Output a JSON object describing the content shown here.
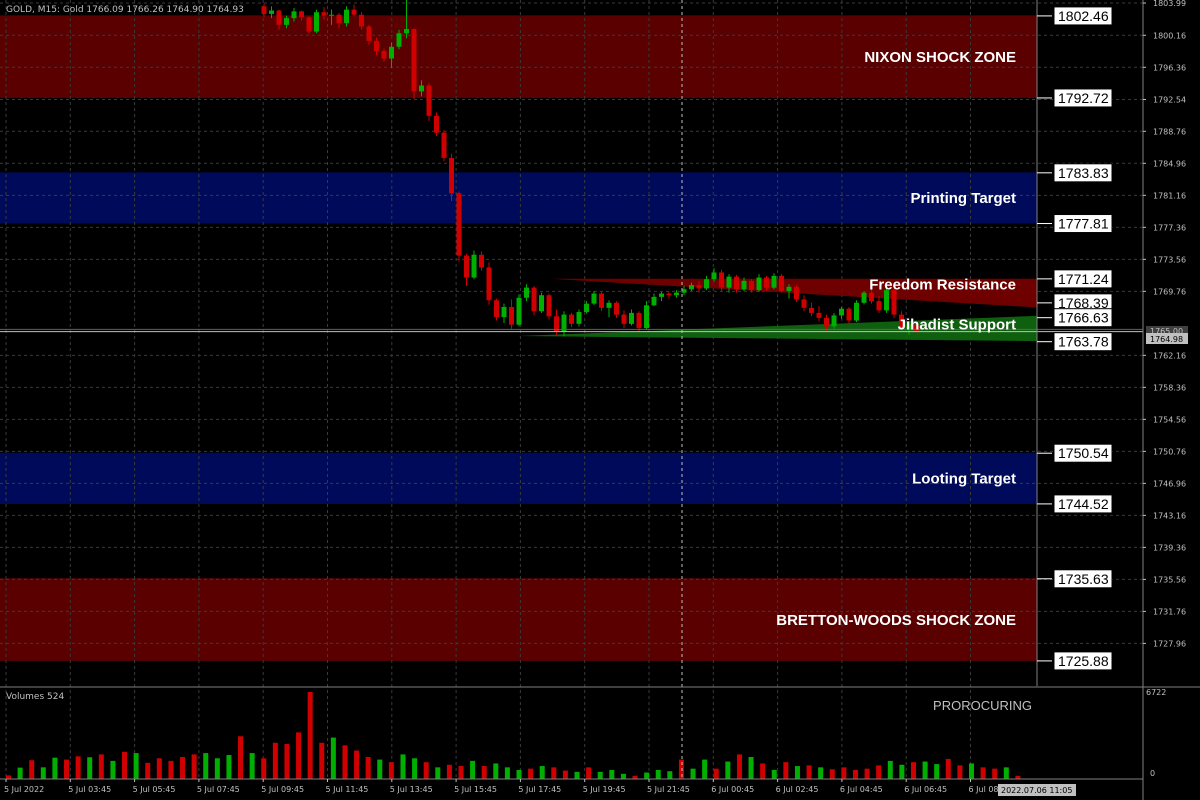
{
  "header": {
    "symbol_line": "GOLD, M15:  Gold  1766.09 1766.26 1764.90 1764.93",
    "volume_label": "Volumes 524",
    "watermark": "PROROCURING",
    "current_price": "1764.98",
    "crosshair_price": "1765.00",
    "crosshair_time": "2022.07.06 11:05"
  },
  "zones": [
    {
      "name": "nixon-shock-zone",
      "label": "NIXON SHOCK ZONE",
      "top": 1802.46,
      "bottom": 1792.72,
      "color": "#5a0000"
    },
    {
      "name": "printing-target",
      "label": "Printing Target",
      "top": 1783.83,
      "bottom": 1777.81,
      "color": "#000a5a"
    },
    {
      "name": "looting-target",
      "label": "Looting Target",
      "top": 1750.54,
      "bottom": 1744.52,
      "color": "#000a5a"
    },
    {
      "name": "bretton-woods-shock-zone",
      "label": "BRETTON-WOODS SHOCK ZONE",
      "top": 1735.63,
      "bottom": 1725.88,
      "color": "#5a0000"
    }
  ],
  "wedges": [
    {
      "name": "freedom-resistance",
      "label": "Freedom Resistance",
      "color": "#7a0000",
      "lines": [
        {
          "from": [
            "5 Jul 17:45",
            1771.25
          ],
          "to": [
            "6 Jul 11:00",
            1771.25
          ]
        },
        {
          "from": [
            "5 Jul 17:45",
            1771.25
          ],
          "to": [
            "6 Jul 11:00",
            1767.85
          ]
        }
      ]
    },
    {
      "name": "jihadist-support",
      "label": "Jihadist Support",
      "color": "#0f6a0f",
      "lines": [
        {
          "from": [
            "5 Jul 17:15",
            1764.45
          ],
          "to": [
            "6 Jul 11:00",
            1766.85
          ]
        },
        {
          "from": [
            "5 Jul 17:15",
            1764.45
          ],
          "to": [
            "6 Jul 11:00",
            1763.85
          ]
        }
      ]
    }
  ],
  "level_labels": [
    "1802.46",
    "1792.72",
    "1783.83",
    "1777.81",
    "1771.24",
    "1768.39",
    "1766.63",
    "1763.78",
    "1750.54",
    "1744.52",
    "1735.63",
    "1725.88"
  ],
  "price_axis_ticks": [
    "1803.99",
    "1800.16",
    "1796.36",
    "1792.54",
    "1788.76",
    "1784.96",
    "1781.16",
    "1777.36",
    "1773.56",
    "1769.76",
    "1762.16",
    "1758.36",
    "1754.56",
    "1750.76",
    "1746.96",
    "1743.16",
    "1739.36",
    "1735.56",
    "1731.76",
    "1727.96"
  ],
  "time_axis_ticks": [
    "5 Jul 2022",
    "5 Jul 03:45",
    "5 Jul 05:45",
    "5 Jul 07:45",
    "5 Jul 09:45",
    "5 Jul 11:45",
    "5 Jul 13:45",
    "5 Jul 15:45",
    "5 Jul 17:45",
    "5 Jul 19:45",
    "5 Jul 21:45",
    "6 Jul 00:45",
    "6 Jul 02:45",
    "6 Jul 04:45",
    "6 Jul 06:45",
    "6 Jul 08:45"
  ],
  "volume_axis": {
    "max": "6722",
    "min": "0"
  },
  "colors": {
    "bull": "#00b000",
    "bear": "#d00000",
    "grid": "#3a3a3a",
    "axis": "#c0c0c0",
    "current_line": "#c0c0c0",
    "crosshair": "#c0c0c0"
  },
  "chart_data": {
    "type": "candlestick",
    "symbol": "GOLD",
    "timeframe": "M15",
    "x": [
      "5 Jul 2022",
      "5 Jul 03:45",
      "5 Jul 05:45",
      "5 Jul 07:45",
      "5 Jul 09:45",
      "5 Jul 11:45",
      "5 Jul 13:45",
      "5 Jul 15:45",
      "5 Jul 17:45",
      "5 Jul 19:45",
      "5 Jul 21:45",
      "6 Jul 00:45",
      "6 Jul 02:45",
      "6 Jul 04:45",
      "6 Jul 06:45",
      "6 Jul 08:45"
    ],
    "ylim": [
      1722.9,
      1804.35
    ],
    "y_ticks": [
      1803.99,
      1800.16,
      1796.36,
      1792.54,
      1788.76,
      1784.96,
      1781.16,
      1777.36,
      1773.56,
      1769.76,
      1762.16,
      1758.36,
      1754.56,
      1750.76,
      1746.96,
      1743.16,
      1739.36,
      1735.56,
      1731.76,
      1727.96
    ],
    "current_price": 1764.98,
    "candles": [
      {
        "o": 1803.6,
        "h": 1803.9,
        "l": 1802.3,
        "c": 1802.7,
        "v": 280
      },
      {
        "o": 1802.7,
        "h": 1803.6,
        "l": 1802.2,
        "c": 1803.1,
        "v": 880
      },
      {
        "o": 1803.1,
        "h": 1803.2,
        "l": 1800.8,
        "c": 1801.4,
        "v": 1450
      },
      {
        "o": 1801.4,
        "h": 1802.5,
        "l": 1801.0,
        "c": 1802.2,
        "v": 900
      },
      {
        "o": 1802.2,
        "h": 1803.4,
        "l": 1801.8,
        "c": 1803.0,
        "v": 1650
      },
      {
        "o": 1803.0,
        "h": 1803.1,
        "l": 1801.9,
        "c": 1802.3,
        "v": 1500
      },
      {
        "o": 1802.3,
        "h": 1802.4,
        "l": 1800.3,
        "c": 1800.6,
        "v": 1750
      },
      {
        "o": 1800.6,
        "h": 1803.2,
        "l": 1800.4,
        "c": 1802.9,
        "v": 1680
      },
      {
        "o": 1802.9,
        "h": 1803.5,
        "l": 1802.0,
        "c": 1802.5,
        "v": 1900
      },
      {
        "o": 1802.5,
        "h": 1803.2,
        "l": 1801.4,
        "c": 1802.6,
        "v": 1400
      },
      {
        "o": 1802.6,
        "h": 1802.8,
        "l": 1801.0,
        "c": 1801.6,
        "v": 2100
      },
      {
        "o": 1801.6,
        "h": 1803.6,
        "l": 1801.2,
        "c": 1803.2,
        "v": 2000
      },
      {
        "o": 1803.2,
        "h": 1803.8,
        "l": 1802.4,
        "c": 1802.6,
        "v": 1250
      },
      {
        "o": 1802.6,
        "h": 1802.9,
        "l": 1800.8,
        "c": 1801.2,
        "v": 1600
      },
      {
        "o": 1801.2,
        "h": 1801.4,
        "l": 1799.0,
        "c": 1799.5,
        "v": 1400
      },
      {
        "o": 1799.5,
        "h": 1799.9,
        "l": 1797.8,
        "c": 1798.3,
        "v": 1700
      },
      {
        "o": 1798.3,
        "h": 1798.6,
        "l": 1797.0,
        "c": 1797.4,
        "v": 1900
      },
      {
        "o": 1797.4,
        "h": 1799.3,
        "l": 1796.3,
        "c": 1798.8,
        "v": 2000
      },
      {
        "o": 1798.8,
        "h": 1800.8,
        "l": 1798.5,
        "c": 1800.4,
        "v": 1600
      },
      {
        "o": 1800.4,
        "h": 1806.0,
        "l": 1799.8,
        "c": 1800.9,
        "v": 1850
      },
      {
        "o": 1800.9,
        "h": 1801.0,
        "l": 1792.6,
        "c": 1793.5,
        "v": 3300
      },
      {
        "o": 1793.5,
        "h": 1794.8,
        "l": 1792.9,
        "c": 1794.2,
        "v": 2000
      },
      {
        "o": 1794.2,
        "h": 1794.5,
        "l": 1790.0,
        "c": 1790.6,
        "v": 1600
      },
      {
        "o": 1790.6,
        "h": 1791.0,
        "l": 1788.2,
        "c": 1788.6,
        "v": 2800
      },
      {
        "o": 1788.6,
        "h": 1788.9,
        "l": 1785.2,
        "c": 1785.6,
        "v": 2700
      },
      {
        "o": 1785.6,
        "h": 1786.1,
        "l": 1780.5,
        "c": 1781.4,
        "v": 3600
      },
      {
        "o": 1781.4,
        "h": 1781.6,
        "l": 1773.3,
        "c": 1774.0,
        "v": 6722
      },
      {
        "o": 1774.0,
        "h": 1774.2,
        "l": 1770.4,
        "c": 1771.4,
        "v": 2800
      },
      {
        "o": 1771.4,
        "h": 1774.6,
        "l": 1771.2,
        "c": 1774.1,
        "v": 3200
      },
      {
        "o": 1774.1,
        "h": 1774.5,
        "l": 1772.2,
        "c": 1772.6,
        "v": 2600
      },
      {
        "o": 1772.6,
        "h": 1773.2,
        "l": 1768.2,
        "c": 1768.7,
        "v": 2200
      },
      {
        "o": 1768.7,
        "h": 1768.9,
        "l": 1766.3,
        "c": 1766.7,
        "v": 1700
      },
      {
        "o": 1766.7,
        "h": 1768.3,
        "l": 1766.0,
        "c": 1767.9,
        "v": 1500
      },
      {
        "o": 1767.9,
        "h": 1768.8,
        "l": 1765.3,
        "c": 1765.8,
        "v": 1300
      },
      {
        "o": 1765.8,
        "h": 1769.4,
        "l": 1765.6,
        "c": 1769.0,
        "v": 1900
      },
      {
        "o": 1769.0,
        "h": 1770.6,
        "l": 1768.6,
        "c": 1770.2,
        "v": 1600
      },
      {
        "o": 1770.2,
        "h": 1770.4,
        "l": 1766.9,
        "c": 1767.4,
        "v": 1300
      },
      {
        "o": 1767.4,
        "h": 1769.6,
        "l": 1767.2,
        "c": 1769.3,
        "v": 900
      },
      {
        "o": 1769.3,
        "h": 1769.5,
        "l": 1766.4,
        "c": 1766.8,
        "v": 1100
      },
      {
        "o": 1766.8,
        "h": 1767.6,
        "l": 1764.6,
        "c": 1765.0,
        "v": 1000
      },
      {
        "o": 1765.0,
        "h": 1767.4,
        "l": 1764.4,
        "c": 1767.0,
        "v": 1400
      },
      {
        "o": 1767.0,
        "h": 1767.2,
        "l": 1765.5,
        "c": 1765.9,
        "v": 1000
      },
      {
        "o": 1765.9,
        "h": 1767.6,
        "l": 1765.6,
        "c": 1767.3,
        "v": 1200
      },
      {
        "o": 1767.3,
        "h": 1768.6,
        "l": 1767.1,
        "c": 1768.3,
        "v": 900
      },
      {
        "o": 1768.3,
        "h": 1769.8,
        "l": 1768.1,
        "c": 1769.5,
        "v": 700
      },
      {
        "o": 1769.5,
        "h": 1769.7,
        "l": 1767.4,
        "c": 1767.8,
        "v": 800
      },
      {
        "o": 1767.8,
        "h": 1768.7,
        "l": 1766.7,
        "c": 1768.4,
        "v": 1000
      },
      {
        "o": 1768.4,
        "h": 1768.6,
        "l": 1766.6,
        "c": 1767.0,
        "v": 900
      },
      {
        "o": 1767.0,
        "h": 1767.5,
        "l": 1765.4,
        "c": 1765.9,
        "v": 650
      },
      {
        "o": 1765.9,
        "h": 1767.6,
        "l": 1765.7,
        "c": 1767.2,
        "v": 550
      },
      {
        "o": 1767.2,
        "h": 1767.4,
        "l": 1765.0,
        "c": 1765.4,
        "v": 900
      },
      {
        "o": 1765.4,
        "h": 1768.6,
        "l": 1765.2,
        "c": 1768.1,
        "v": 550
      },
      {
        "o": 1768.1,
        "h": 1769.5,
        "l": 1768.0,
        "c": 1769.1,
        "v": 700
      },
      {
        "o": 1769.1,
        "h": 1769.7,
        "l": 1768.6,
        "c": 1769.5,
        "v": 400
      },
      {
        "o": 1769.5,
        "h": 1769.7,
        "l": 1768.9,
        "c": 1769.3,
        "v": 250
      },
      {
        "o": 1769.3,
        "h": 1769.9,
        "l": 1769.0,
        "c": 1769.6,
        "v": 500
      },
      {
        "o": 1769.6,
        "h": 1770.4,
        "l": 1769.3,
        "c": 1770.0,
        "v": 700
      },
      {
        "o": 1770.0,
        "h": 1770.8,
        "l": 1769.8,
        "c": 1770.5,
        "v": 600
      },
      {
        "o": 1770.5,
        "h": 1771.0,
        "l": 1769.6,
        "c": 1770.1,
        "v": 1500
      },
      {
        "o": 1770.1,
        "h": 1771.6,
        "l": 1769.9,
        "c": 1771.2,
        "v": 800
      },
      {
        "o": 1771.2,
        "h": 1772.5,
        "l": 1770.9,
        "c": 1772.0,
        "v": 1500
      },
      {
        "o": 1772.0,
        "h": 1772.3,
        "l": 1769.8,
        "c": 1770.2,
        "v": 800
      },
      {
        "o": 1770.2,
        "h": 1771.8,
        "l": 1769.6,
        "c": 1771.5,
        "v": 1350
      },
      {
        "o": 1771.5,
        "h": 1771.7,
        "l": 1769.6,
        "c": 1770.0,
        "v": 1900
      },
      {
        "o": 1770.0,
        "h": 1771.4,
        "l": 1769.8,
        "c": 1771.0,
        "v": 1700
      },
      {
        "o": 1771.0,
        "h": 1771.2,
        "l": 1769.6,
        "c": 1769.9,
        "v": 1200
      },
      {
        "o": 1769.9,
        "h": 1771.8,
        "l": 1769.7,
        "c": 1771.4,
        "v": 700
      },
      {
        "o": 1771.4,
        "h": 1771.6,
        "l": 1769.8,
        "c": 1770.2,
        "v": 1300
      },
      {
        "o": 1770.2,
        "h": 1771.9,
        "l": 1770.0,
        "c": 1771.6,
        "v": 1000
      },
      {
        "o": 1771.6,
        "h": 1771.8,
        "l": 1769.6,
        "c": 1769.8,
        "v": 1050
      },
      {
        "o": 1769.8,
        "h": 1770.6,
        "l": 1768.9,
        "c": 1770.3,
        "v": 900
      },
      {
        "o": 1770.3,
        "h": 1770.5,
        "l": 1768.5,
        "c": 1768.8,
        "v": 750
      },
      {
        "o": 1768.8,
        "h": 1769.3,
        "l": 1767.4,
        "c": 1767.8,
        "v": 900
      },
      {
        "o": 1767.8,
        "h": 1768.4,
        "l": 1766.8,
        "c": 1767.2,
        "v": 700
      },
      {
        "o": 1767.2,
        "h": 1768.0,
        "l": 1766.2,
        "c": 1766.6,
        "v": 800
      },
      {
        "o": 1766.6,
        "h": 1767.0,
        "l": 1765.1,
        "c": 1765.6,
        "v": 1050
      },
      {
        "o": 1765.6,
        "h": 1767.2,
        "l": 1765.3,
        "c": 1766.9,
        "v": 1400
      },
      {
        "o": 1766.9,
        "h": 1767.9,
        "l": 1766.5,
        "c": 1767.7,
        "v": 1100
      },
      {
        "o": 1767.7,
        "h": 1767.9,
        "l": 1765.9,
        "c": 1766.3,
        "v": 1300
      },
      {
        "o": 1766.3,
        "h": 1768.7,
        "l": 1766.1,
        "c": 1768.4,
        "v": 1350
      },
      {
        "o": 1768.4,
        "h": 1769.8,
        "l": 1768.2,
        "c": 1769.6,
        "v": 1150
      },
      {
        "o": 1769.6,
        "h": 1770.0,
        "l": 1768.3,
        "c": 1768.6,
        "v": 1550
      },
      {
        "o": 1768.6,
        "h": 1769.2,
        "l": 1767.2,
        "c": 1767.5,
        "v": 1050
      },
      {
        "o": 1767.5,
        "h": 1770.6,
        "l": 1767.2,
        "c": 1769.9,
        "v": 1200
      },
      {
        "o": 1769.9,
        "h": 1770.1,
        "l": 1766.6,
        "c": 1767.0,
        "v": 900
      },
      {
        "o": 1767.0,
        "h": 1767.4,
        "l": 1764.7,
        "c": 1765.2,
        "v": 800
      },
      {
        "o": 1765.2,
        "h": 1766.1,
        "l": 1764.6,
        "c": 1765.8,
        "v": 900
      },
      {
        "o": 1765.8,
        "h": 1766.2,
        "l": 1764.9,
        "c": 1765.1,
        "v": 250
      }
    ],
    "volume_ylim": [
      0,
      6722
    ]
  }
}
